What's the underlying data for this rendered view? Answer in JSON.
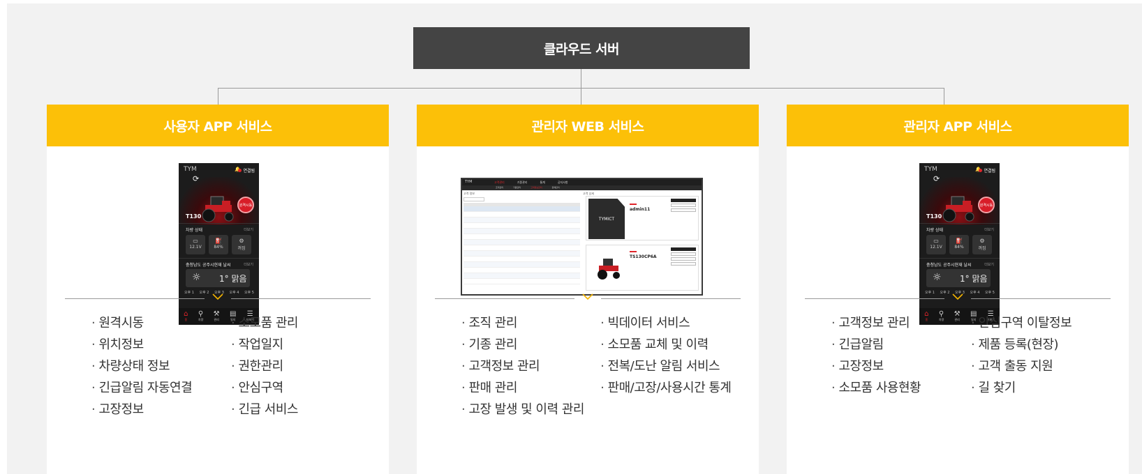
{
  "server": {
    "label": "클라우드 서버"
  },
  "columns": [
    {
      "title": "사용자 APP 서비스",
      "features_left": [
        "원격시동",
        "위치정보",
        "차량상태 정보",
        "긴급알림 자동연결",
        "고장정보"
      ],
      "features_right": [
        "소모품 관리",
        "작업일지",
        "권한관리",
        "안심구역",
        "긴급 서비스"
      ]
    },
    {
      "title": "관리자 WEB 서비스",
      "features_left": [
        "조직 관리",
        "기종 관리",
        "고객정보 관리",
        "판매 관리",
        "고장 발생 및 이력 관리"
      ],
      "features_right": [
        "빅데이터 서비스",
        "소모품 교체 및 이력",
        "전복/도난 알림 서비스",
        "판매/고장/사용시간 통계"
      ]
    },
    {
      "title": "관리자 APP 서비스",
      "features_left": [
        "고객정보 관리",
        "긴급알림",
        "고장정보",
        "소모품 사용현황"
      ],
      "features_right": [
        "안심구역 이탈정보",
        "제품 등록(현장)",
        "고객 출동 지원",
        "길 찾기"
      ]
    }
  ],
  "phone": {
    "logo": "TYM",
    "status": "연결됨",
    "model": "T130",
    "start_button": "원격시동",
    "vehicle_status_title": "차량 상태",
    "more": "더보기",
    "stats": [
      {
        "icon": "battery-icon",
        "value": "12.1V"
      },
      {
        "icon": "fuel-icon",
        "value": "84%"
      },
      {
        "icon": "engine-icon",
        "value": "꺼짐"
      }
    ],
    "weather_title": "충청남도 공주시현재 날씨",
    "weather_value": "1° 맑음",
    "forecast": [
      "오후 1",
      "오후 2",
      "오후 3",
      "오후 4",
      "오후 5"
    ],
    "nav": [
      "홈",
      "차량",
      "관리",
      "일지",
      "더보기"
    ]
  },
  "web": {
    "logo": "TYM",
    "menu": [
      "고객관리",
      "기종관리",
      "통계",
      "공지사항"
    ],
    "submenu": [
      "조직관리",
      "기종관리",
      "고객정보관리",
      "판매관리"
    ],
    "list_title": "고객 정보",
    "detail_title": "고객 상세",
    "brand": "TYMICT",
    "account": "admin11",
    "machine": "TS130CP6A"
  }
}
